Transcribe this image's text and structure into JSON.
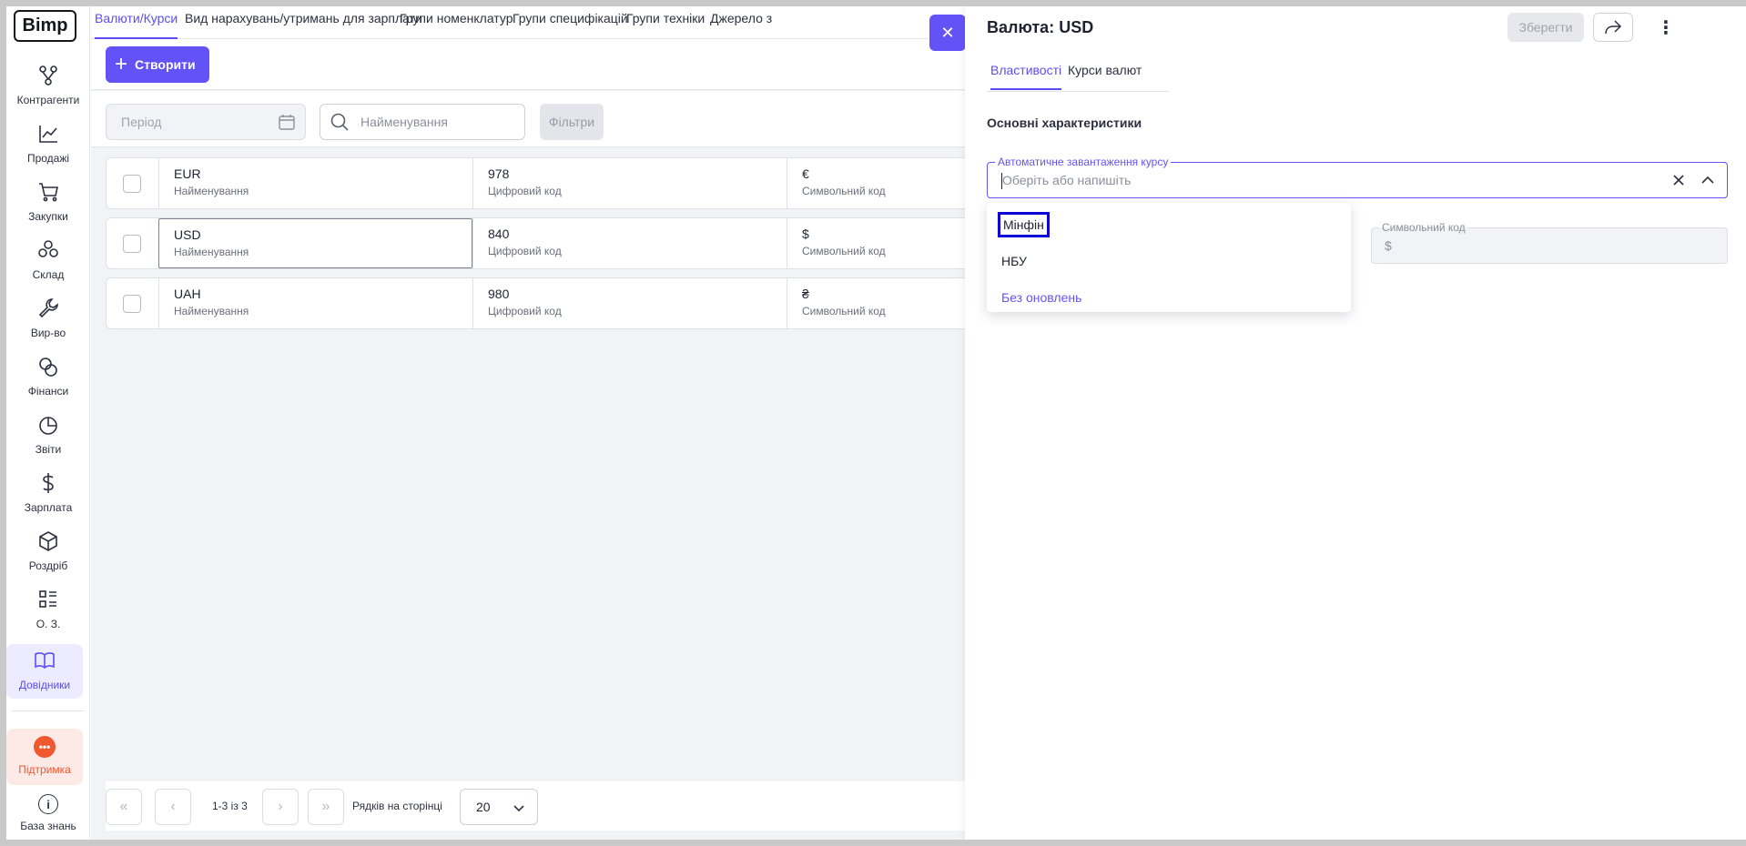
{
  "sidebar": {
    "logo": "Bimp",
    "items": [
      {
        "label": "Контрагенти",
        "icon": "hierarchy-icon"
      },
      {
        "label": "Продажі",
        "icon": "chart-line-icon"
      },
      {
        "label": "Закупки",
        "icon": "cart-icon"
      },
      {
        "label": "Склад",
        "icon": "boxes-icon"
      },
      {
        "label": "Вир-во",
        "icon": "wrench-icon"
      },
      {
        "label": "Фінанси",
        "icon": "coins-icon"
      },
      {
        "label": "Звіти",
        "icon": "pie-chart-icon"
      },
      {
        "label": "Зарплата",
        "icon": "dollar-icon"
      },
      {
        "label": "Роздріб",
        "icon": "cube-icon"
      },
      {
        "label": "О. З.",
        "icon": "grid-list-icon"
      },
      {
        "label": "Довідники",
        "icon": "book-icon"
      }
    ],
    "support_label": "Підтримка",
    "kb_label": "База знань"
  },
  "tabs": [
    "Валюти/Курси",
    "Вид нарахувань/утримань для зарплати",
    "Групи номенклатур",
    "Групи специфікацій",
    "Групи техніки",
    "Джерело з"
  ],
  "toolbar": {
    "create_label": "Створити"
  },
  "filters": {
    "period_placeholder": "Період",
    "search_placeholder": "Найменування",
    "filters_label": "Фільтри"
  },
  "table": {
    "rows": [
      {
        "name": "EUR",
        "name_label": "Найменування",
        "code": "978",
        "code_label": "Цифровий код",
        "symbol": "€",
        "symbol_label": "Символьний код"
      },
      {
        "name": "USD",
        "name_label": "Найменування",
        "code": "840",
        "code_label": "Цифровий код",
        "symbol": "$",
        "symbol_label": "Символьний код"
      },
      {
        "name": "UAH",
        "name_label": "Найменування",
        "code": "980",
        "code_label": "Цифровий код",
        "symbol": "₴",
        "symbol_label": "Символьний код"
      }
    ]
  },
  "pager": {
    "info": "1-3 із 3",
    "rows_label": "Рядків на сторінці",
    "rows_value": "20"
  },
  "drawer": {
    "title": "Валюта: USD",
    "save_label": "Зберегти",
    "tabs": [
      "Властивості",
      "Курси валют"
    ],
    "section_title": "Основні характеристики",
    "auto_field": {
      "legend": "Автоматичне завантаження курсу",
      "placeholder": "Оберіть або напишіть"
    },
    "symbol_field": {
      "legend": "Символьний код",
      "value": "$"
    },
    "options": [
      "Мінфін",
      "НБУ",
      "Без оновлень"
    ]
  }
}
